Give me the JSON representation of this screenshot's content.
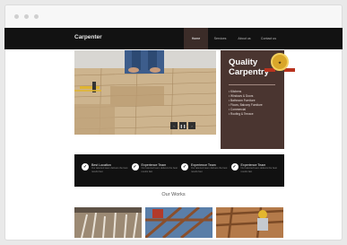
{
  "site": {
    "logo": "Carpenter"
  },
  "menu": [
    {
      "label": "Home",
      "active": true
    },
    {
      "label": "Services",
      "active": false
    },
    {
      "label": "About us",
      "active": false
    },
    {
      "label": "Contact us",
      "active": false
    }
  ],
  "hero": {
    "slider_prev_icon": "arrow-left-icon",
    "slider_pause_icon": "pause-icon",
    "slider_next_icon": "arrow-right-icon",
    "slider_prev": "‹",
    "slider_pause": "❚❚",
    "slider_next": "›"
  },
  "panel": {
    "title": "Quality Carpentry",
    "items": [
      "Kitchens",
      "Windows & Doors",
      "Bathroom Furniture",
      "Floors, Balcony Furniture",
      "Commercial",
      "Roofing & Terrace"
    ],
    "background": "#4a3530"
  },
  "badge": {
    "icon": "award-seal-icon"
  },
  "features": [
    {
      "title": "Best Location",
      "desc": "Our talented team delivers the best results fast"
    },
    {
      "title": "Experience Team",
      "desc": "Our talented team delivers the best results fast"
    },
    {
      "title": "Experience Team",
      "desc": "Our talented team delivers the best results fast"
    },
    {
      "title": "Experience Team",
      "desc": "Our talented team delivers the best results fast"
    }
  ],
  "works": {
    "title": "Our Works"
  },
  "colors": {
    "accent": "#3b2c28",
    "dark": "#121212"
  }
}
